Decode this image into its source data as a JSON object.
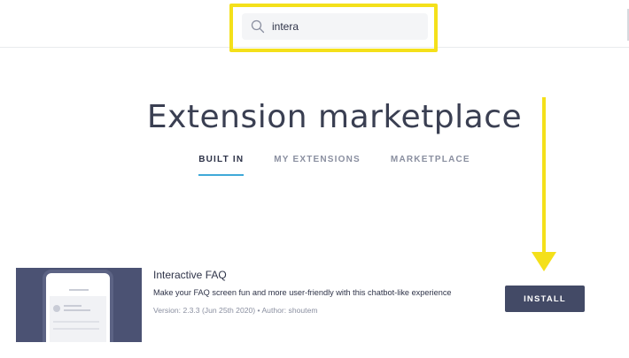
{
  "search": {
    "value": "intera",
    "icon": "search-icon"
  },
  "main": {
    "title": "Extension marketplace",
    "tabs": [
      {
        "label": "BUILT IN",
        "active": true
      },
      {
        "label": "MY EXTENSIONS",
        "active": false
      },
      {
        "label": "MARKETPLACE",
        "active": false
      }
    ]
  },
  "extension": {
    "name": "Interactive FAQ",
    "description": "Make your FAQ screen fun and more user-friendly with this chatbot-like experience",
    "meta": "Version: 2.3.3 (Jun 25th 2020) • Author: shoutem",
    "install_label": "INSTALL"
  },
  "colors": {
    "highlight": "#f4e01a",
    "accent": "#3fa9d8",
    "button": "#434a66",
    "thumbnail": "#4b5273"
  }
}
